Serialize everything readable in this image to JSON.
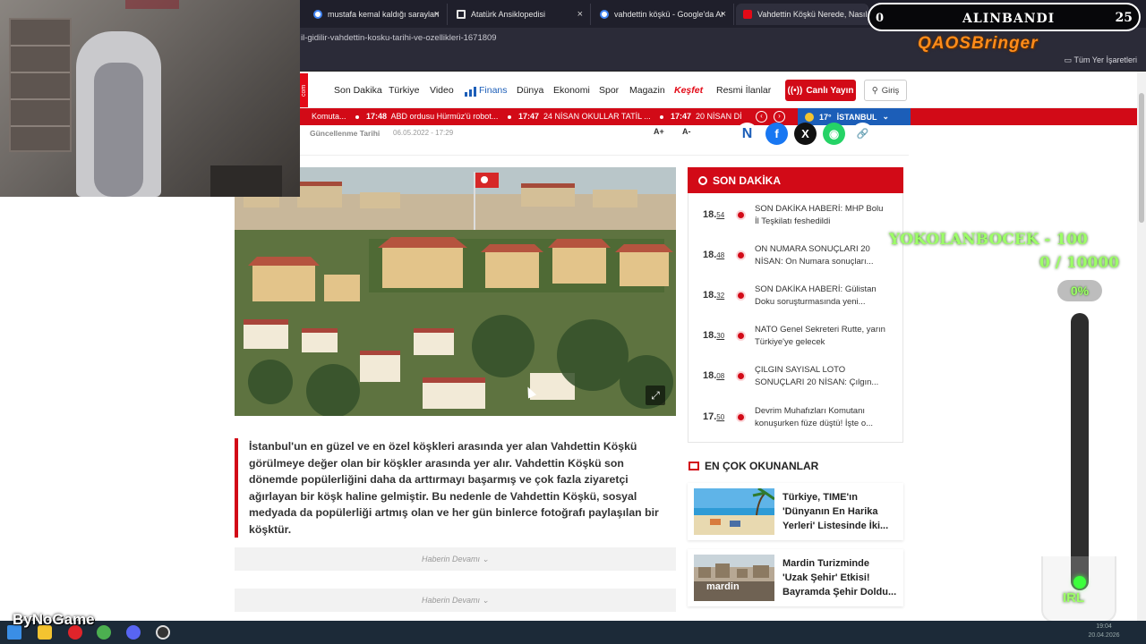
{
  "browser": {
    "tabs": [
      {
        "label": "mustafa kemal kaldığı sarayları",
        "close": "×"
      },
      {
        "label": "Atatürk Ansiklopedisi",
        "close": "×"
      },
      {
        "label": "vahdettin köşkü - Google'da Ar",
        "close": "×"
      },
      {
        "label": "Vahdettin Köşkü Nerede, Nasıl",
        "close": "×"
      }
    ],
    "url": "il-gidilir-vahdettin-kosku-tarihi-ve-ozellikleri-1671809",
    "all_bookmarks": "Tüm Yer İşaretleri"
  },
  "site": {
    "logo_text": "com",
    "nav": [
      "Son Dakika",
      "Türkiye",
      "Video",
      "Finans",
      "Dünya",
      "Ekonomi",
      "Spor",
      "Magazin",
      "Keşfet",
      "Resmi İlanlar"
    ],
    "live_button": "Canlı Yayın",
    "login_button": "Giriş"
  },
  "ticker": {
    "lead": "Komuta...",
    "items": [
      {
        "time": "17:48",
        "text": "ABD ordusu Hürmüz'ü robot..."
      },
      {
        "time": "17:47",
        "text": "24 NİSAN OKULLAR TATİL ..."
      },
      {
        "time": "17:47",
        "text": "20 NİSAN Dİ"
      }
    ],
    "prev": "‹",
    "next": "›",
    "weather": {
      "temp": "17°",
      "city": "İSTANBUL"
    }
  },
  "article": {
    "updated_label": "Güncellenme Tarihi",
    "updated_date": "06.05.2022 - 17:29",
    "font_up": "A+",
    "font_down": "A-",
    "lede": "İstanbul'un en güzel ve en özel köşkleri arasında yer alan Vahdettin Köşkü görülmeye değer olan bir köşkler arasında yer alır. Vahdettin Köşkü son dönemde popülerliğini daha da arttırmayı başarmış ve çok fazla ziyaretçi ağırlayan bir köşk haline gelmiştir. Bu nedenle de Vahdettin Köşkü, sosyal medyada da popülerliği artmış olan ve her gün binlerce fotoğrafı paylaşılan bir köşktür.",
    "continue_label": "Haberin Devamı"
  },
  "son_dakika": {
    "title": "SON DAKİKA",
    "items": [
      {
        "hour": "18.",
        "minute": "54",
        "text": "SON DAKİKA HABERİ: MHP Bolu İl Teşkilatı feshedildi"
      },
      {
        "hour": "18.",
        "minute": "48",
        "text": "ON NUMARA SONUÇLARI 20 NİSAN: On Numara sonuçları..."
      },
      {
        "hour": "18.",
        "minute": "32",
        "text": "SON DAKİKA HABERİ: Gülistan Doku soruşturmasında yeni..."
      },
      {
        "hour": "18.",
        "minute": "30",
        "text": "NATO Genel Sekreteri Rutte, yarın Türkiye'ye gelecek"
      },
      {
        "hour": "18.",
        "minute": "08",
        "text": "ÇILGIN SAYISAL LOTO SONUÇLARI 20 NİSAN: Çılgın..."
      },
      {
        "hour": "17.",
        "minute": "50",
        "text": "Devrim Muhafızları Komutanı konuşurken füze düştü! İşte o..."
      }
    ]
  },
  "en_cok": {
    "title": "EN ÇOK OKUNANLAR",
    "items": [
      {
        "text": "Türkiye, TIME'ın 'Dünyanın En Harika Yerleri' Listesinde İki..."
      },
      {
        "text": "Mardin Turizminde 'Uzak Şehir' Etkisi! Bayramda Şehir Doldu..."
      }
    ],
    "image_caption": "mardin"
  },
  "overlay": {
    "alinband_label": "ALINBANDI",
    "alinband_left": "0",
    "alinband_right": "25",
    "qaos": "QAOSBringer",
    "goal_name": "YOKOLANBOCEK - 100",
    "goal_count": "0 / 10000",
    "goal_percent": "0%",
    "goal_progress": 0,
    "irl": "IRL",
    "brand": "ByNoGame"
  },
  "taskbar": {
    "time": "19:04",
    "date": "20.04.2026"
  },
  "colors": {
    "brand_red": "#d20a17",
    "finance_blue": "#1c5eb8",
    "overlay_green": "#9cff66"
  }
}
